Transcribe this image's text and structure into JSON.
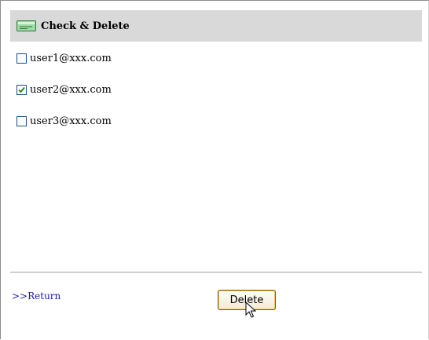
{
  "header": {
    "icon": "email-card-icon",
    "title": "Check & Delete"
  },
  "items": [
    {
      "label": "user1@xxx.com",
      "checked": false
    },
    {
      "label": "user2@xxx.com",
      "checked": true
    },
    {
      "label": "user3@xxx.com",
      "checked": false
    }
  ],
  "footer": {
    "return_label": ">>Return",
    "delete_label": "Delete"
  },
  "colors": {
    "header_bg": "#d9d9d9",
    "link": "#1a1aa6",
    "checkmark": "#1a8a1a",
    "button_focus": "#f5c363"
  },
  "cursor_icon": "arrow-pointer-icon"
}
